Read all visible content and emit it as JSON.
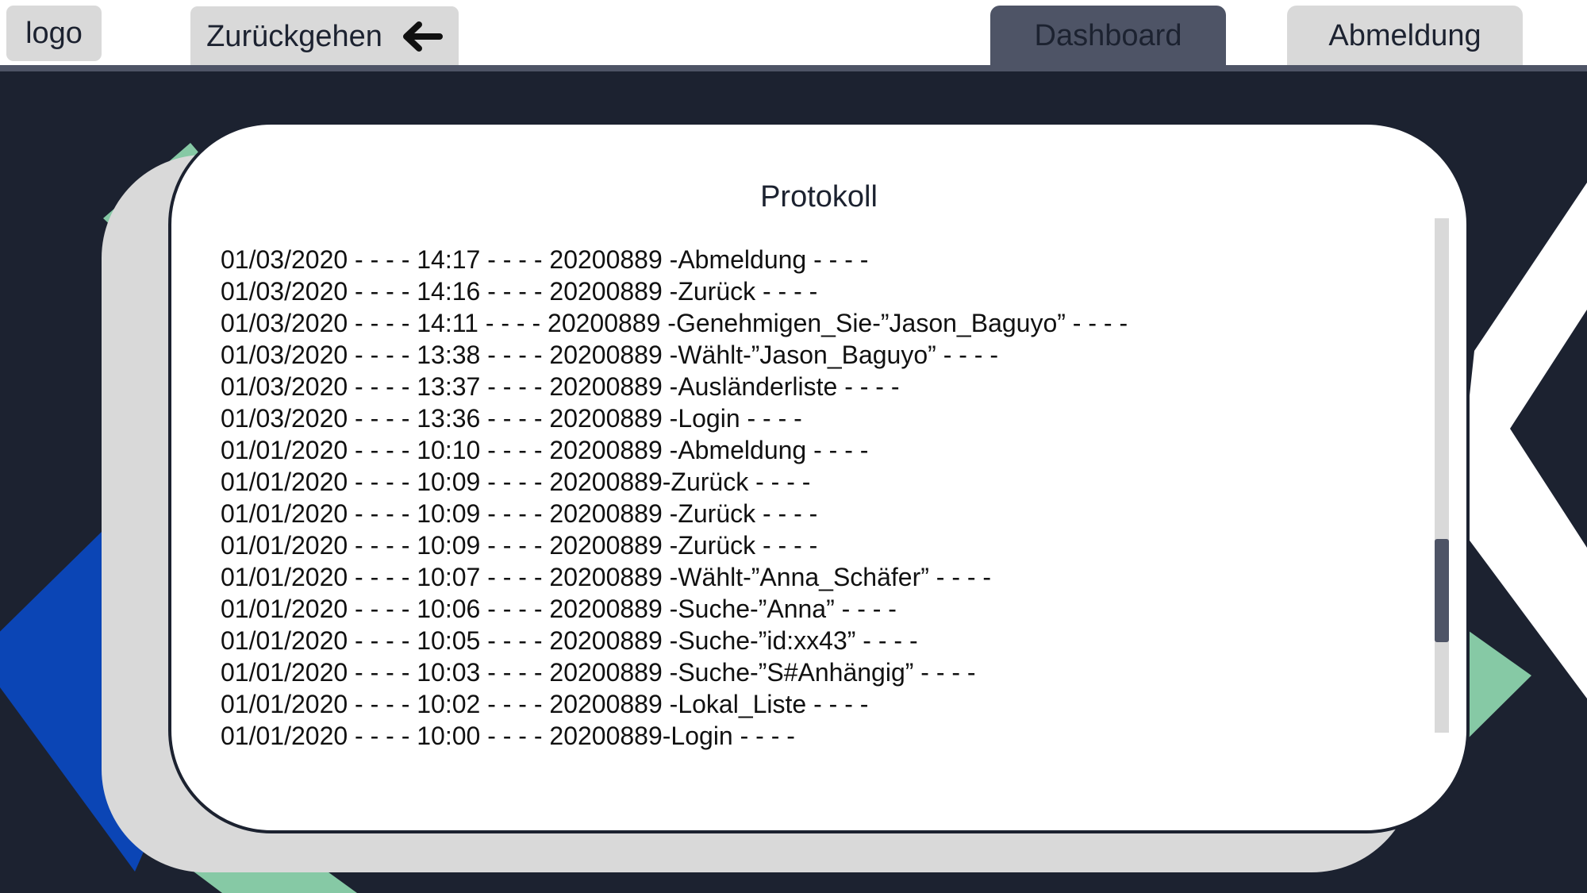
{
  "nav": {
    "logo_label": "logo",
    "back_label": "Zurückgehen",
    "dashboard_label": "Dashboard",
    "logout_label": "Abmeldung"
  },
  "panel": {
    "title": "Protokoll"
  },
  "log": [
    "01/03/2020 - - - - 14:17 - - - - 20200889 -Abmeldung - - - -",
    "01/03/2020 - - - - 14:16 - - - - 20200889 -Zurück - - - -",
    "01/03/2020 - - - - 14:11 - - - - 20200889 -Genehmigen_Sie-”Jason_Baguyo” - - - -",
    "01/03/2020 - - - - 13:38 - - - - 20200889 -Wählt-”Jason_Baguyo” - - - -",
    "01/03/2020 - - - - 13:37 - - - - 20200889 -Ausländerliste - - - -",
    "01/03/2020 - - - - 13:36 - - - - 20200889 -Login - - - -",
    "01/01/2020 - - - - 10:10 - - - - 20200889 -Abmeldung - - - -",
    "01/01/2020 - - - - 10:09 - - - - 20200889-Zurück - - - -",
    "01/01/2020 - - - - 10:09 - - - - 20200889 -Zurück - - - -",
    "01/01/2020 - - - - 10:09 - - - - 20200889 -Zurück - - - -",
    "01/01/2020 - - - - 10:07 - - - - 20200889 -Wählt-”Anna_Schäfer” - - - -",
    "01/01/2020 - - - - 10:06 - - - - 20200889 -Suche-”Anna” - - - -",
    "01/01/2020 - - - - 10:05 - - - - 20200889 -Suche-”id:xx43” - - - -",
    "01/01/2020 - - - - 10:03 - - - - 20200889 -Suche-”S#Anhängig” - - - -",
    "01/01/2020 - - - - 10:02 - - - - 20200889 -Lokal_Liste - - - -",
    "01/01/2020 - - - - 10:00 - - - - 20200889-Login - - - -"
  ],
  "scroll": {
    "position_fraction": 0.78
  },
  "colors": {
    "dark_bg": "#1c2230",
    "accent_slate": "#4e5466",
    "button_gray": "#d9d9d9",
    "mint": "#86c9a5",
    "blue": "#0b45b5"
  },
  "icons": {
    "back": "arrow-left-icon"
  }
}
